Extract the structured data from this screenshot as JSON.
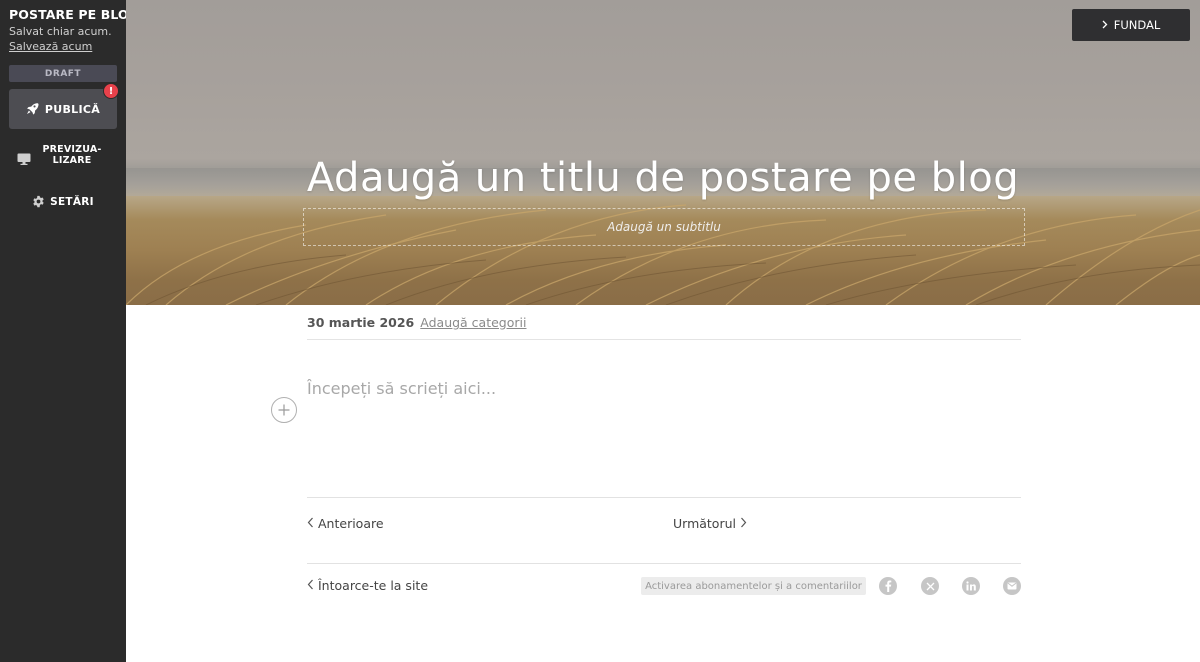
{
  "sidebar": {
    "title": "POSTARE PE BLOG",
    "saved_status": "Salvat chiar acum.",
    "save_now": "Salvează acum",
    "draft_badge": "DRAFT",
    "publish_label": "PUBLICĂ",
    "publish_alert": "!",
    "preview_label": "PREVIZUA-\nLIZARE",
    "settings_label": "SETĂRI",
    "icons": {
      "publish": "rocket-icon",
      "preview": "monitor-icon",
      "settings": "gear-icon"
    },
    "colors": {
      "background": "#2b2b2b",
      "alert": "#e8414b"
    }
  },
  "hero": {
    "background_button": "FUNDAL",
    "title": "Adaugă un titlu de postare pe blog",
    "subtitle_placeholder": "Adaugă un subtitlu"
  },
  "post": {
    "date": "30 martie 2026",
    "add_categories": "Adaugă categorii",
    "body_placeholder": "Începeți să scrieți aici...",
    "add_block_icon": "plus-icon"
  },
  "navigation": {
    "previous": "Anterioare",
    "next": "Următorul",
    "back_to_site": "Întoarce-te la site"
  },
  "footer": {
    "subscriptions_pill": "Activarea abonamentelor și a comentariilor",
    "social_icons": [
      "facebook-icon",
      "x-icon",
      "linkedin-icon",
      "email-icon"
    ]
  }
}
